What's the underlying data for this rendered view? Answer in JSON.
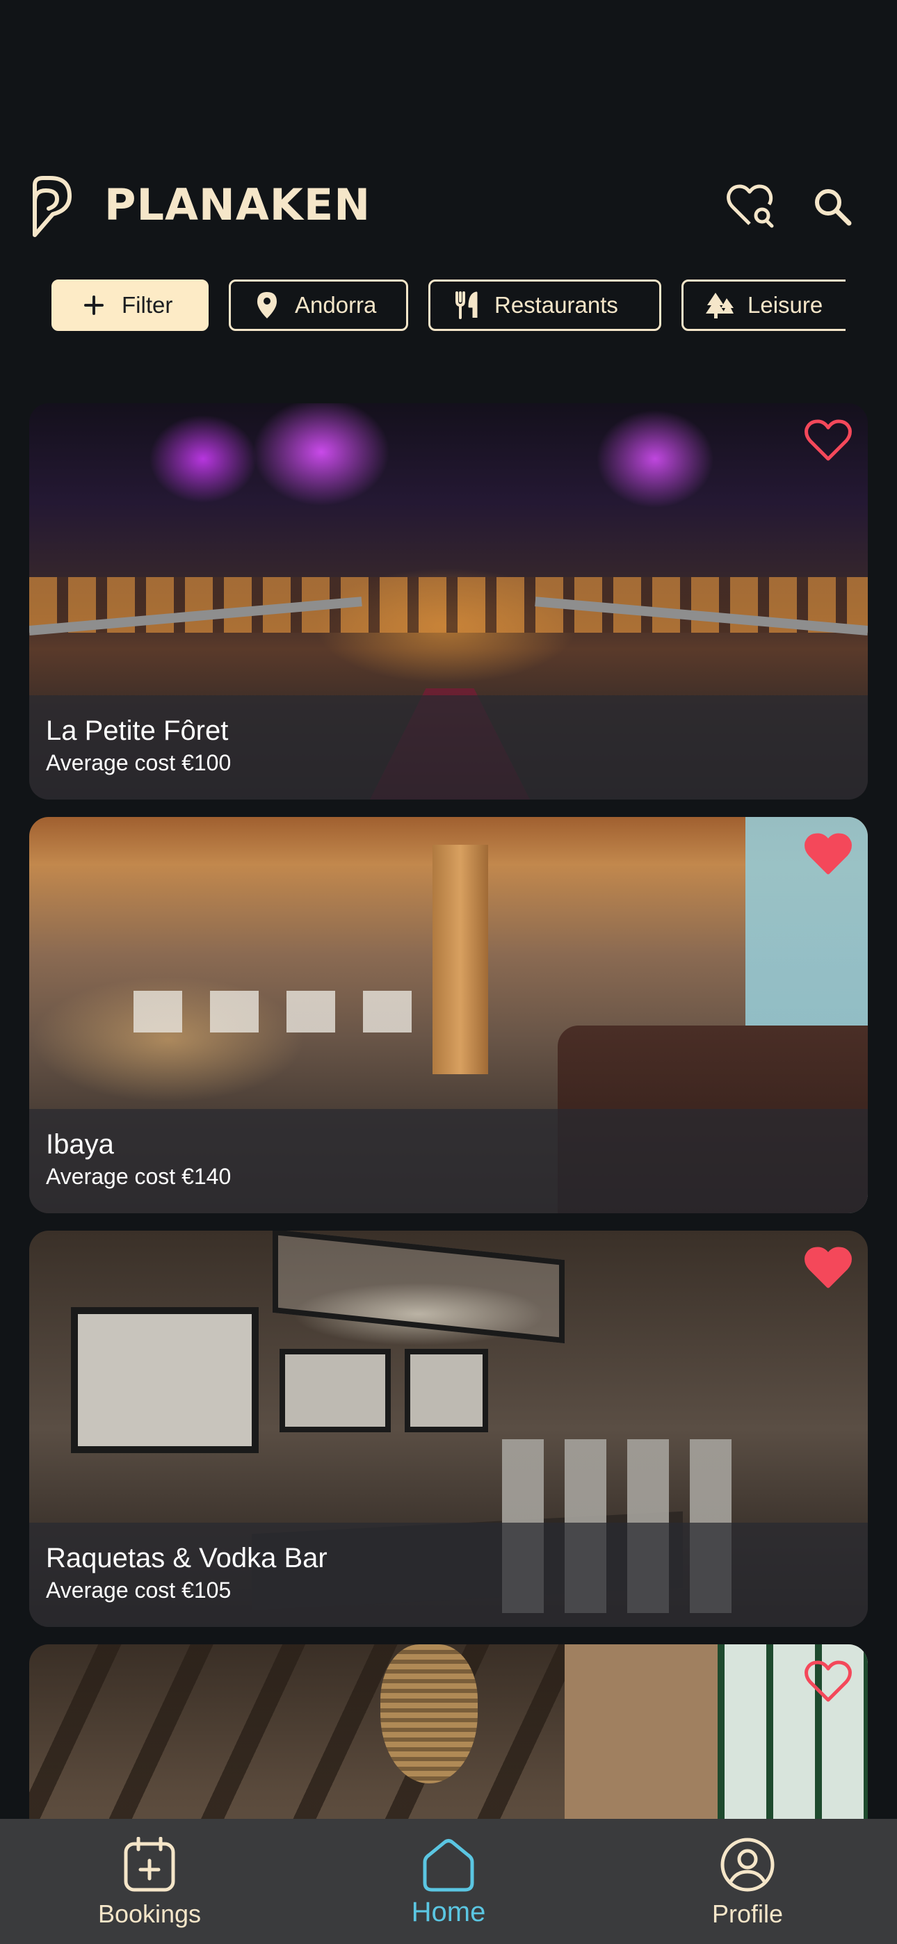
{
  "app": {
    "name": "PLANAKEN"
  },
  "header": {
    "favorites_search_icon": "heart-search-icon",
    "search_icon": "search-icon"
  },
  "chips": [
    {
      "label": "Filter",
      "icon": "plus-icon",
      "active": true
    },
    {
      "label": "Andorra",
      "icon": "location-pin-icon"
    },
    {
      "label": "Restaurants",
      "icon": "fork-knife-icon"
    },
    {
      "label": "Leisure",
      "icon": "trees-icon"
    }
  ],
  "cards": [
    {
      "name": "La Petite Fôret",
      "cost": "Average cost €100",
      "favorited": false
    },
    {
      "name": "Ibaya",
      "cost": "Average cost €140",
      "favorited": true
    },
    {
      "name": "Raquetas & Vodka Bar",
      "cost": "Average cost €105",
      "favorited": true
    },
    {
      "name": "",
      "cost": "",
      "favorited": false
    }
  ],
  "bottom_nav": {
    "items": [
      {
        "label": "Bookings",
        "icon": "calendar-plus-icon"
      },
      {
        "label": "Home",
        "icon": "home-icon",
        "active": true
      },
      {
        "label": "Profile",
        "icon": "user-circle-icon"
      }
    ]
  },
  "colors": {
    "background": "#111417",
    "cream": "#f5e6c9",
    "filter_chip_bg": "#fdebc6",
    "heart": "#f4485a",
    "active_nav": "#5bc6e2",
    "nav_bg": "#3a3b3d"
  }
}
